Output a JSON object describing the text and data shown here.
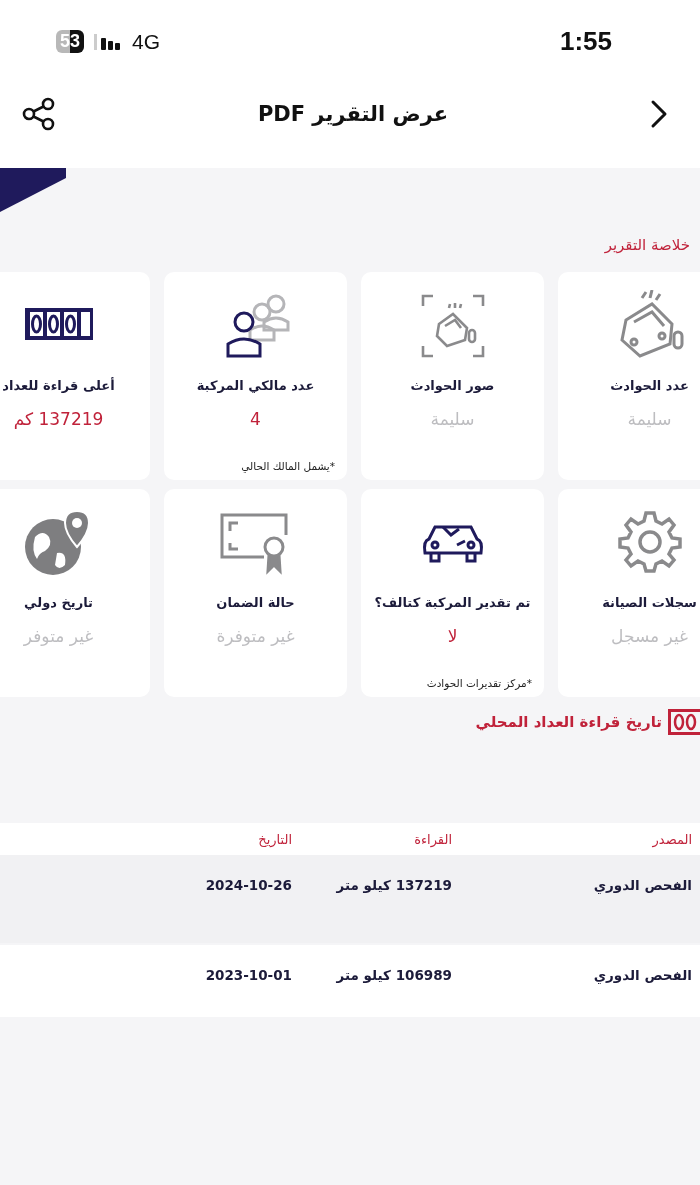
{
  "status_bar": {
    "time": "1:55",
    "network": "4G",
    "battery": "53"
  },
  "nav": {
    "title": "عرض التقرير PDF"
  },
  "summary": {
    "title": "خلاصة التقرير",
    "cards": [
      {
        "title": "عدد الحوادث",
        "value": "سليمة",
        "kind": "clear"
      },
      {
        "title": "صور الحوادث",
        "value": "سليمة",
        "kind": "clear"
      },
      {
        "title": "عدد مالكي المركبة",
        "value": "4",
        "kind": "reported",
        "note": "*يشمل المالك الحالي"
      },
      {
        "title": "أعلى قراءة للعداد",
        "value": "137219 كم",
        "kind": "reported"
      },
      {
        "title": "سجلات الصيانة",
        "value": "غير مسجل",
        "kind": "clear"
      },
      {
        "title": "تم تقدير المركبة كتالف؟",
        "value": "لا",
        "kind": "reported",
        "note": "*مركز تقديرات الحوادث"
      },
      {
        "title": "حالة الضمان",
        "value": "غير متوفرة",
        "kind": "clear"
      },
      {
        "title": "تاريخ دولي",
        "value": "غير متوفر",
        "kind": "clear"
      }
    ]
  },
  "odometer_history": {
    "title": "تاريخ قراءة العداد المحلي",
    "columns": [
      "المصدر",
      "القراءة",
      "التاريخ"
    ],
    "rows": [
      {
        "source": "الفحص الدوري",
        "reading": "137219 كيلو متر",
        "date": "2024-10-26"
      },
      {
        "source": "الفحص الدوري",
        "reading": "106989 كيلو متر",
        "date": "2023-10-01"
      }
    ]
  }
}
